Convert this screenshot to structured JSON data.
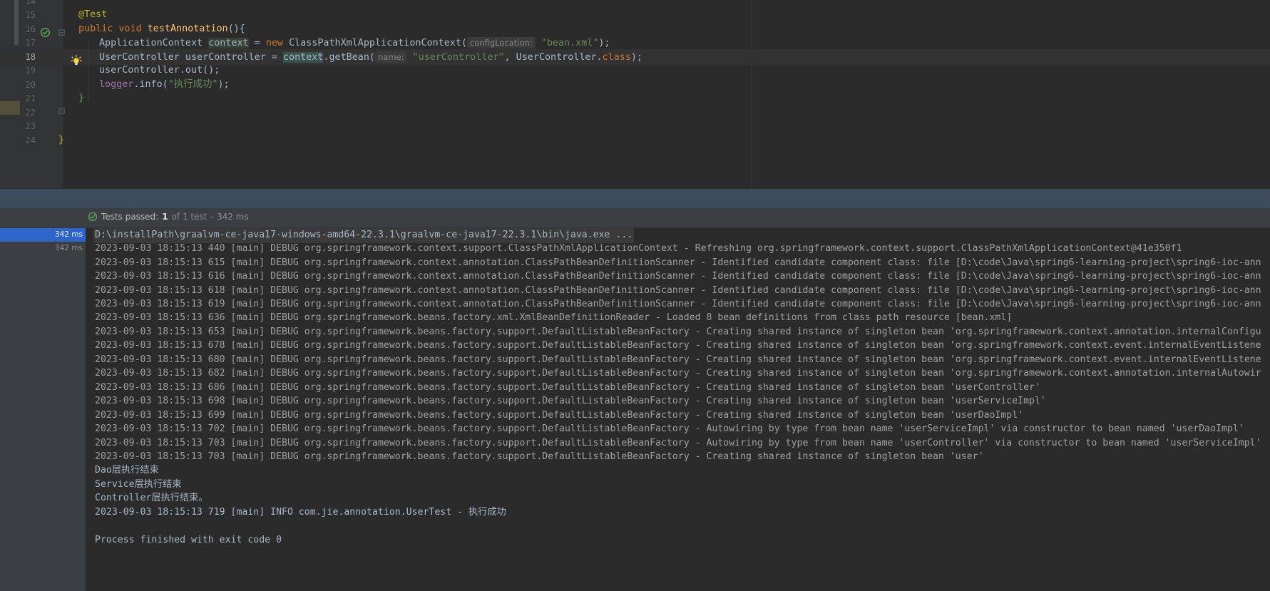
{
  "editor": {
    "lines": [
      {
        "num": "14",
        "tokens": []
      },
      {
        "num": "15",
        "tokens": [
          {
            "t": "@Test",
            "c": "ann"
          }
        ]
      },
      {
        "num": "16",
        "tokens": [
          {
            "t": "public ",
            "c": "kw"
          },
          {
            "t": "void ",
            "c": "kw"
          },
          {
            "t": "testAnnotation",
            "c": "fn"
          },
          {
            "t": "(){",
            "c": ""
          }
        ]
      },
      {
        "num": "17",
        "tokens": [
          {
            "t": "ApplicationContext ",
            "c": ""
          },
          {
            "t": "context",
            "c": "hl-var"
          },
          {
            "t": " = ",
            "c": ""
          },
          {
            "t": "new ",
            "c": "kw"
          },
          {
            "t": "ClassPathXmlApplicationContext(",
            "c": ""
          },
          {
            "t": "configLocation:",
            "c": "hint"
          },
          {
            "t": " ",
            "c": ""
          },
          {
            "t": "\"bean.xml\"",
            "c": "str"
          },
          {
            "t": ");",
            "c": ""
          }
        ]
      },
      {
        "num": "18",
        "tokens": [
          {
            "t": "UserController userController = ",
            "c": ""
          },
          {
            "t": "context",
            "c": "hl-var2"
          },
          {
            "t": ".getBean(",
            "c": ""
          },
          {
            "t": "name:",
            "c": "hint"
          },
          {
            "t": " ",
            "c": ""
          },
          {
            "t": "\"userController\"",
            "c": "str"
          },
          {
            "t": ", UserController.",
            "c": ""
          },
          {
            "t": "class",
            "c": "kw"
          },
          {
            "t": ");",
            "c": ""
          }
        ]
      },
      {
        "num": "19",
        "tokens": [
          {
            "t": "userController.out();",
            "c": ""
          }
        ]
      },
      {
        "num": "20",
        "tokens": [
          {
            "t": "logger",
            "c": "fld"
          },
          {
            "t": ".info(",
            "c": ""
          },
          {
            "t": "\"执行成功\"",
            "c": "str"
          },
          {
            "t": ");",
            "c": ""
          }
        ]
      },
      {
        "num": "21",
        "tokens": [
          {
            "t": "}",
            "c": "br-g"
          }
        ]
      },
      {
        "num": "22",
        "tokens": []
      },
      {
        "num": "23",
        "tokens": []
      },
      {
        "num": "24",
        "tokens": [
          {
            "t": "}",
            "c": "ann"
          }
        ]
      }
    ],
    "current_line": "18"
  },
  "test_status": {
    "label": "Tests passed:",
    "count": "1",
    "rest": "of 1 test – 342 ms"
  },
  "tree": {
    "rows": [
      {
        "time": "342 ms",
        "selected": true
      },
      {
        "time": "342 ms",
        "selected": false
      }
    ]
  },
  "console": {
    "lines": [
      {
        "text": "D:\\installPath\\graalvm-ce-java17-windows-amd64-22.3.1\\graalvm-ce-java17-22.3.1\\bin\\java.exe ...",
        "kind": "cmd"
      },
      {
        "text": "2023-09-03 18:15:13 440 [main] DEBUG org.springframework.context.support.ClassPathXmlApplicationContext - Refreshing org.springframework.context.support.ClassPathXmlApplicationContext@41e350f1",
        "kind": "debug"
      },
      {
        "text": "2023-09-03 18:15:13 615 [main] DEBUG org.springframework.context.annotation.ClassPathBeanDefinitionScanner - Identified candidate component class: file [D:\\code\\Java\\spring6-learning-project\\spring6-ioc-ann",
        "kind": "debug"
      },
      {
        "text": "2023-09-03 18:15:13 616 [main] DEBUG org.springframework.context.annotation.ClassPathBeanDefinitionScanner - Identified candidate component class: file [D:\\code\\Java\\spring6-learning-project\\spring6-ioc-ann",
        "kind": "debug"
      },
      {
        "text": "2023-09-03 18:15:13 618 [main] DEBUG org.springframework.context.annotation.ClassPathBeanDefinitionScanner - Identified candidate component class: file [D:\\code\\Java\\spring6-learning-project\\spring6-ioc-ann",
        "kind": "debug"
      },
      {
        "text": "2023-09-03 18:15:13 619 [main] DEBUG org.springframework.context.annotation.ClassPathBeanDefinitionScanner - Identified candidate component class: file [D:\\code\\Java\\spring6-learning-project\\spring6-ioc-ann",
        "kind": "debug"
      },
      {
        "text": "2023-09-03 18:15:13 636 [main] DEBUG org.springframework.beans.factory.xml.XmlBeanDefinitionReader - Loaded 8 bean definitions from class path resource [bean.xml]",
        "kind": "debug"
      },
      {
        "text": "2023-09-03 18:15:13 653 [main] DEBUG org.springframework.beans.factory.support.DefaultListableBeanFactory - Creating shared instance of singleton bean 'org.springframework.context.annotation.internalConfigu",
        "kind": "debug"
      },
      {
        "text": "2023-09-03 18:15:13 678 [main] DEBUG org.springframework.beans.factory.support.DefaultListableBeanFactory - Creating shared instance of singleton bean 'org.springframework.context.event.internalEventListene",
        "kind": "debug"
      },
      {
        "text": "2023-09-03 18:15:13 680 [main] DEBUG org.springframework.beans.factory.support.DefaultListableBeanFactory - Creating shared instance of singleton bean 'org.springframework.context.event.internalEventListene",
        "kind": "debug"
      },
      {
        "text": "2023-09-03 18:15:13 682 [main] DEBUG org.springframework.beans.factory.support.DefaultListableBeanFactory - Creating shared instance of singleton bean 'org.springframework.context.annotation.internalAutowir",
        "kind": "debug"
      },
      {
        "text": "2023-09-03 18:15:13 686 [main] DEBUG org.springframework.beans.factory.support.DefaultListableBeanFactory - Creating shared instance of singleton bean 'userController'",
        "kind": "debug"
      },
      {
        "text": "2023-09-03 18:15:13 698 [main] DEBUG org.springframework.beans.factory.support.DefaultListableBeanFactory - Creating shared instance of singleton bean 'userServiceImpl'",
        "kind": "debug"
      },
      {
        "text": "2023-09-03 18:15:13 699 [main] DEBUG org.springframework.beans.factory.support.DefaultListableBeanFactory - Creating shared instance of singleton bean 'userDaoImpl'",
        "kind": "debug"
      },
      {
        "text": "2023-09-03 18:15:13 702 [main] DEBUG org.springframework.beans.factory.support.DefaultListableBeanFactory - Autowiring by type from bean name 'userServiceImpl' via constructor to bean named 'userDaoImpl'",
        "kind": "debug"
      },
      {
        "text": "2023-09-03 18:15:13 703 [main] DEBUG org.springframework.beans.factory.support.DefaultListableBeanFactory - Autowiring by type from bean name 'userController' via constructor to bean named 'userServiceImpl'",
        "kind": "debug"
      },
      {
        "text": "2023-09-03 18:15:13 703 [main] DEBUG org.springframework.beans.factory.support.DefaultListableBeanFactory - Creating shared instance of singleton bean 'user'",
        "kind": "debug"
      },
      {
        "text": "Dao层执行结束",
        "kind": "out"
      },
      {
        "text": "Service层执行结束",
        "kind": "out"
      },
      {
        "text": "Controller层执行结束。",
        "kind": "out"
      },
      {
        "text": "2023-09-03 18:15:13 719 [main] INFO com.jie.annotation.UserTest - 执行成功",
        "kind": "out"
      },
      {
        "text": "",
        "kind": "out"
      },
      {
        "text": "Process finished with exit code 0",
        "kind": "out"
      }
    ]
  },
  "icons": {
    "run": "run-passed-icon",
    "bulb": "intention-bulb-icon",
    "check": "test-passed-check-icon",
    "fold": "fold-marker-icon"
  },
  "colors": {
    "passed": "#5ea55a",
    "selection": "#2f65ca",
    "bulb": "#f5d442"
  }
}
